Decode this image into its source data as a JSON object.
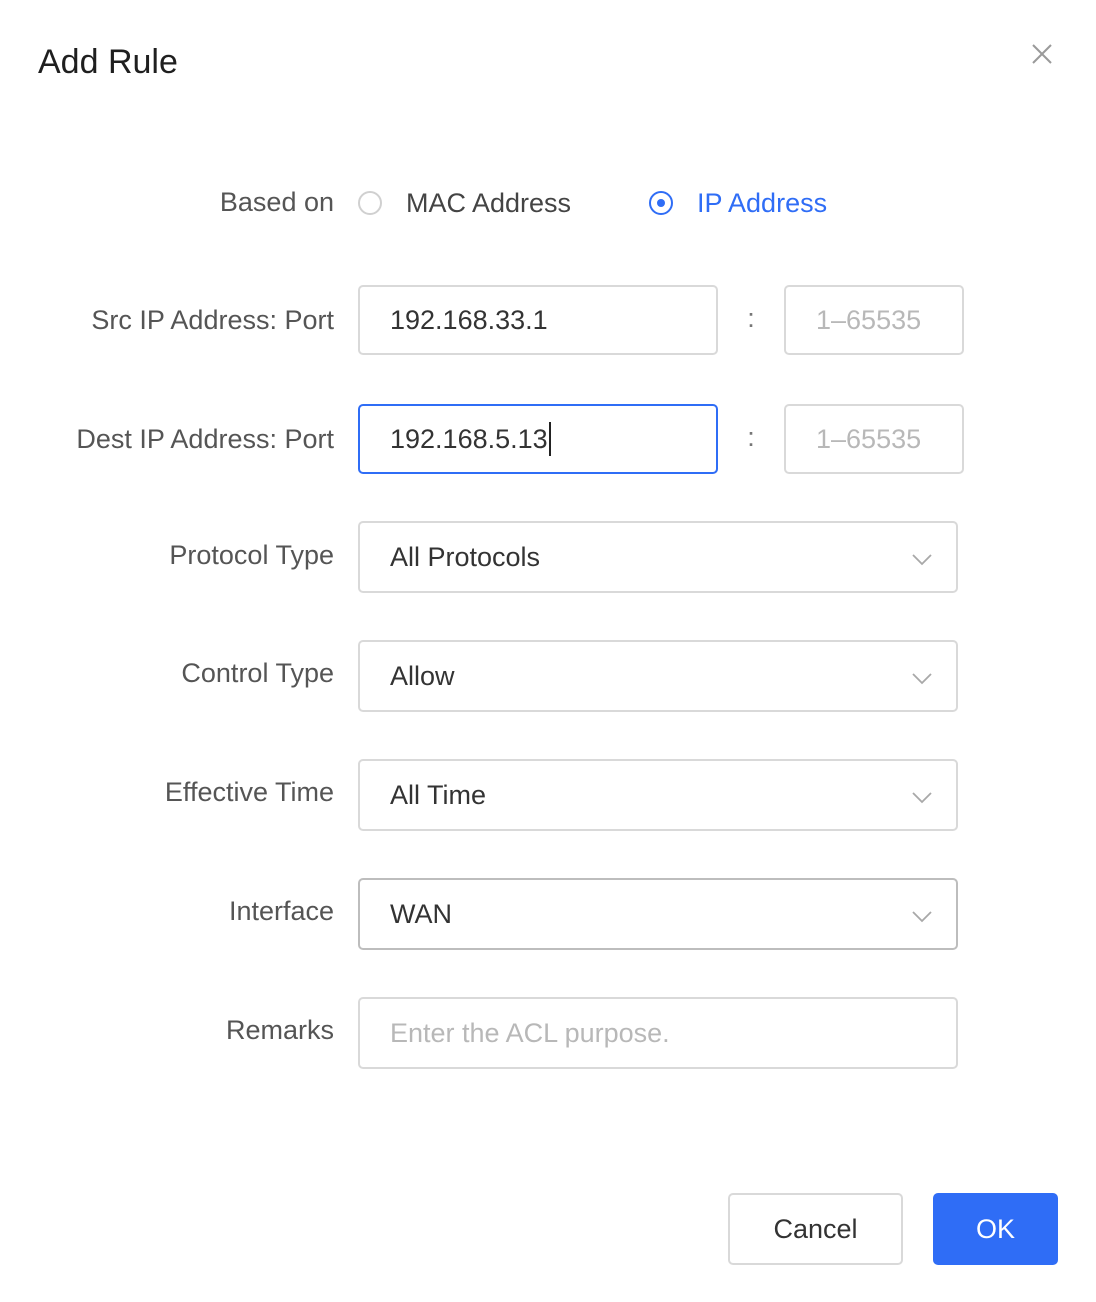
{
  "dialog": {
    "title": "Add Rule",
    "close_icon": "close-icon"
  },
  "based_on": {
    "label": "Based on",
    "options": [
      {
        "label": "MAC Address",
        "checked": false
      },
      {
        "label": "IP Address",
        "checked": true
      }
    ]
  },
  "src": {
    "label": "Src IP Address: Port",
    "ip_value": "192.168.33.1",
    "separator": ":",
    "port_placeholder": "1–65535"
  },
  "dest": {
    "label": "Dest IP Address: Port",
    "ip_value": "192.168.5.13",
    "separator": ":",
    "port_placeholder": "1–65535"
  },
  "protocol": {
    "label": "Protocol Type",
    "selected": "All Protocols"
  },
  "control": {
    "label": "Control Type",
    "selected": "Allow"
  },
  "effective_time": {
    "label": "Effective Time",
    "selected": "All Time"
  },
  "interface": {
    "label": "Interface",
    "selected": "WAN"
  },
  "remarks": {
    "label": "Remarks",
    "placeholder": "Enter the ACL purpose."
  },
  "footer": {
    "cancel_label": "Cancel",
    "ok_label": "OK"
  },
  "colors": {
    "accent": "#2f6df6",
    "border": "#d9d9d9",
    "placeholder": "#b8b8b8"
  }
}
